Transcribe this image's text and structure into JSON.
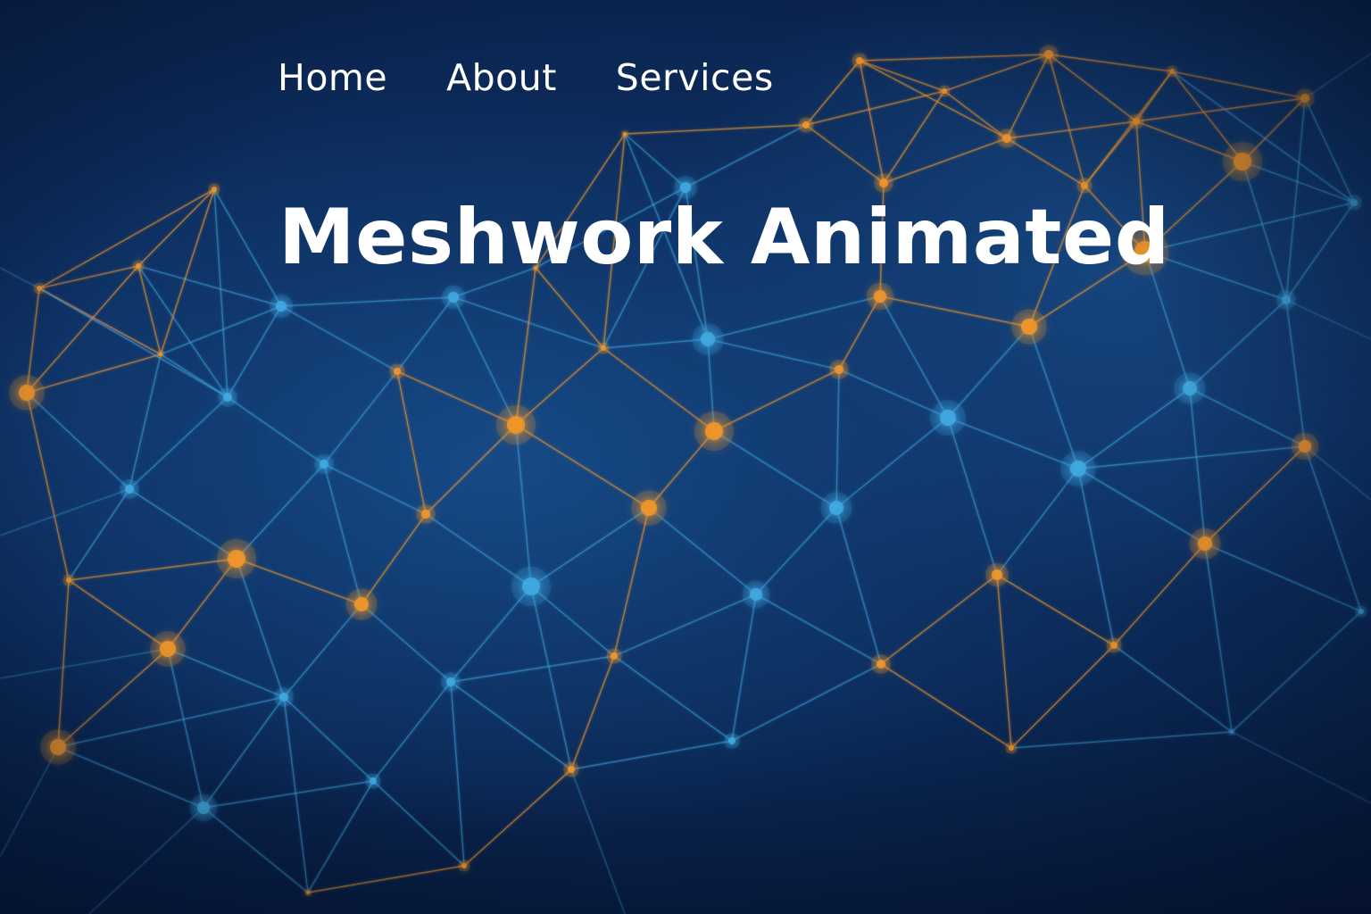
{
  "nav": {
    "items": [
      {
        "label": "Home"
      },
      {
        "label": "About"
      },
      {
        "label": "Services"
      }
    ]
  },
  "hero": {
    "title": "Meshwork Animated"
  },
  "colors": {
    "background": "#0b2652",
    "mesh_blue": "#3fa9e0",
    "mesh_orange": "#f0962a",
    "text": "#ffffff"
  }
}
